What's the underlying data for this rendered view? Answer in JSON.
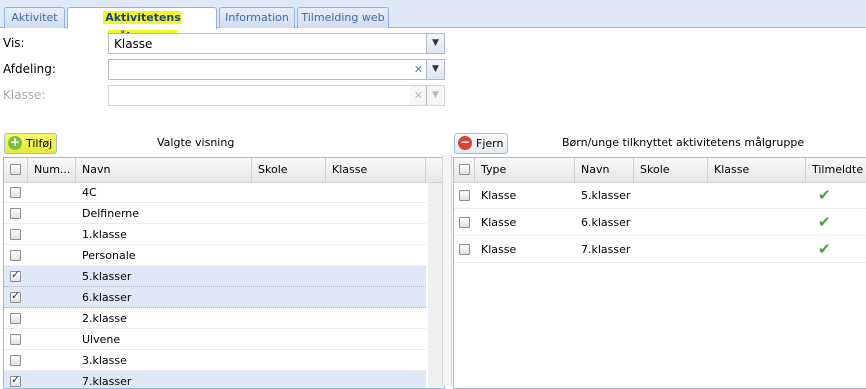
{
  "tabs": [
    {
      "label": "Aktivitet"
    },
    {
      "label": "Aktivitetens målgruppe"
    },
    {
      "label": "Information"
    },
    {
      "label": "Tilmelding web"
    }
  ],
  "form": {
    "vis_label": "Vis:",
    "vis_value": "Klasse",
    "afdeling_label": "Afdeling:",
    "afdeling_value": "",
    "klasse_label": "Klasse:",
    "klasse_value": ""
  },
  "left_panel": {
    "add_button": "Tilføj",
    "title": "Valgte visning",
    "columns": [
      "Num...",
      "Navn",
      "Skole",
      "Klasse"
    ],
    "rows": [
      {
        "navn": "4C",
        "checked": false
      },
      {
        "navn": "Delfinerne",
        "checked": false
      },
      {
        "navn": "1.klasse",
        "checked": false
      },
      {
        "navn": "Personale",
        "checked": false
      },
      {
        "navn": "5.klasser",
        "checked": true
      },
      {
        "navn": "6.klasser",
        "checked": true
      },
      {
        "navn": "2.klasse",
        "checked": false
      },
      {
        "navn": "Ulvene",
        "checked": false
      },
      {
        "navn": "3.klasse",
        "checked": false
      },
      {
        "navn": "7.klasser",
        "checked": true
      }
    ]
  },
  "right_panel": {
    "remove_button": "Fjern",
    "title": "Børn/unge tilknyttet aktivitetens målgruppe",
    "columns": [
      "Type",
      "Navn",
      "Skole",
      "Klasse",
      "Tilmeldte"
    ],
    "rows": [
      {
        "type": "Klasse",
        "navn": "5.klasser",
        "tilmeldt": true
      },
      {
        "type": "Klasse",
        "navn": "6.klasser",
        "tilmeldt": true
      },
      {
        "type": "Klasse",
        "navn": "7.klasser",
        "tilmeldt": true
      }
    ]
  },
  "colors": {
    "accent": "#99bbe8",
    "highlight": "#f5f522",
    "selected_row": "#dfe8f6",
    "check_green": "#47a23a",
    "remove_red": "#d9443b",
    "add_green": "#7cbf3a"
  }
}
